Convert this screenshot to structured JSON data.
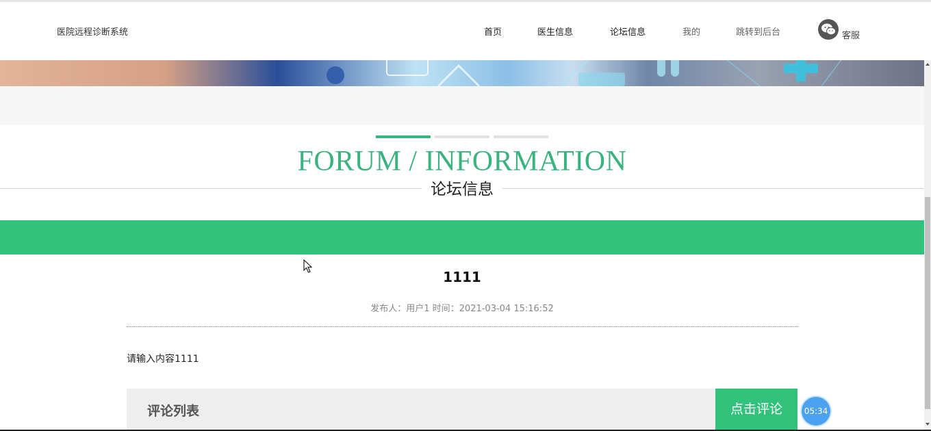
{
  "header": {
    "brand": "医院远程诊断系统",
    "nav": [
      {
        "label": "首页"
      },
      {
        "label": "医生信息"
      },
      {
        "label": "论坛信息"
      },
      {
        "label": "我的"
      },
      {
        "label": "跳转到后台"
      }
    ],
    "service_label": "客服"
  },
  "section": {
    "title_en": "FORUM / INFORMATION",
    "title_cn": "论坛信息"
  },
  "post": {
    "title": "1111",
    "meta": "发布人：用户1 时间：2021-03-04 15:16:52",
    "content": "请输入内容1111"
  },
  "comments": {
    "list_title": "评论列表",
    "button_label": "点击评论"
  },
  "timer": {
    "text": "05:34"
  },
  "colors": {
    "accent": "#33c27c",
    "title_green": "#3bb37f",
    "timer_blue": "#4aa2f0"
  }
}
